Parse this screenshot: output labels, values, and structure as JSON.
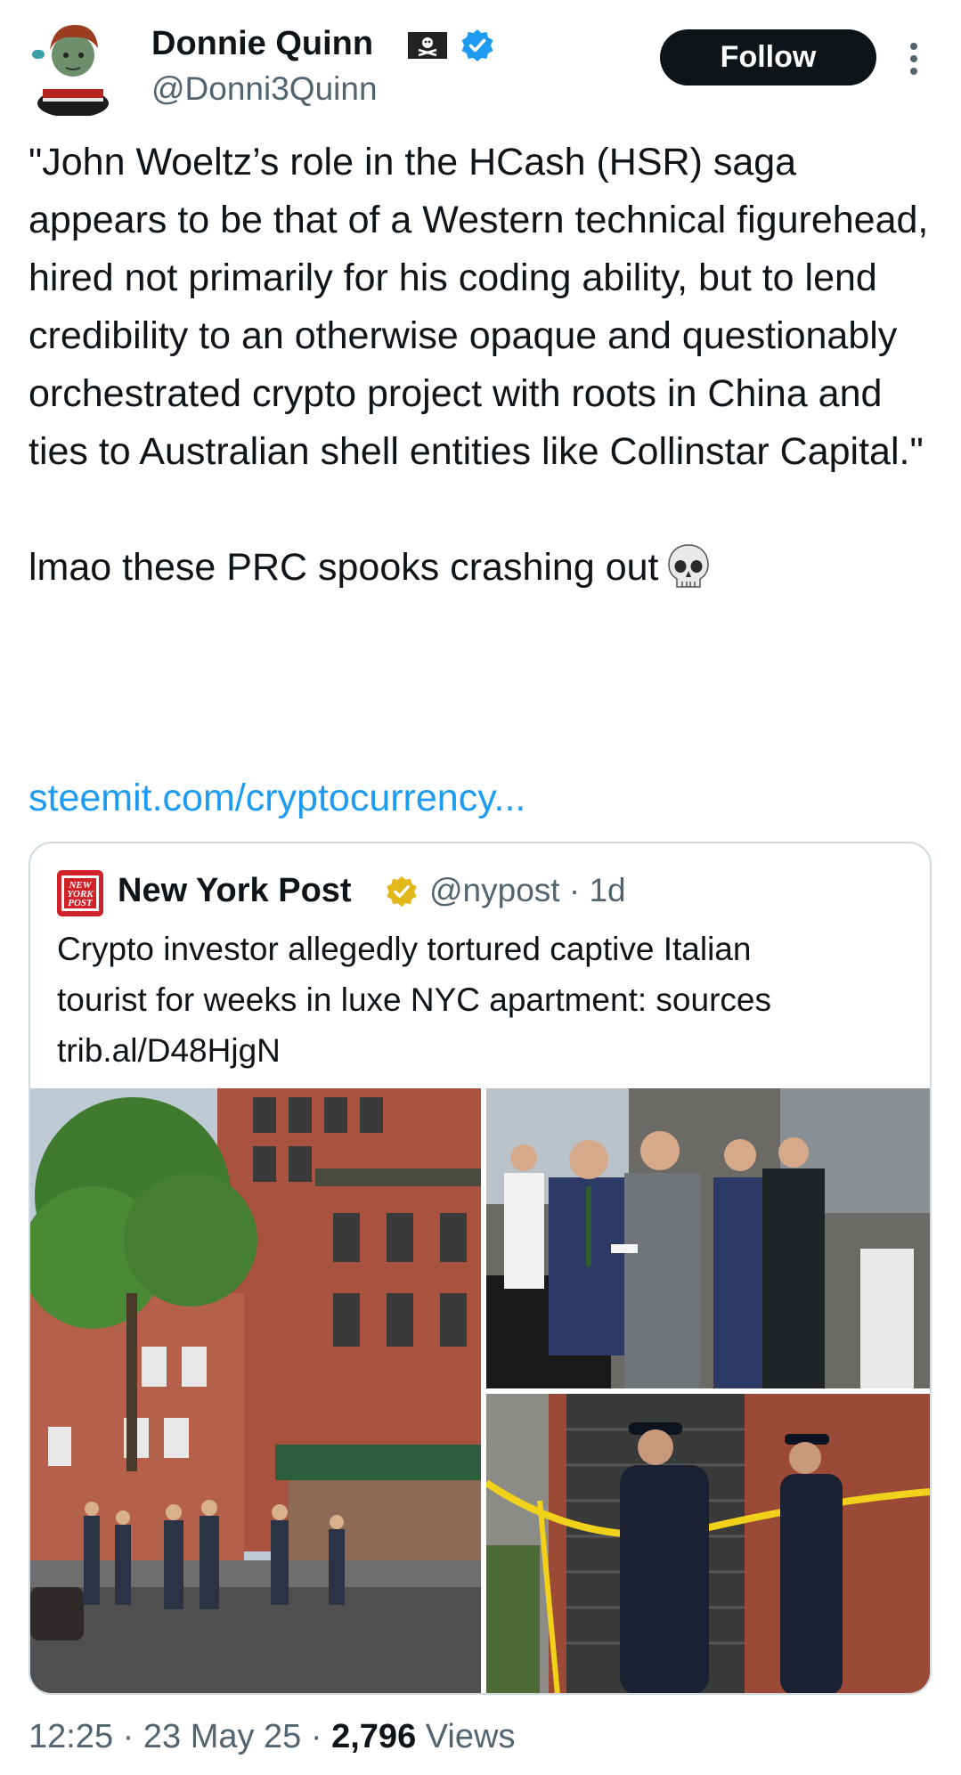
{
  "author": {
    "display_name": "Donnie Quinn",
    "handle": "@Donni3Quinn",
    "badges": [
      "pirate-flag-icon",
      "verified-blue-icon"
    ],
    "verified_color": "#1d9bf0"
  },
  "follow_button": {
    "label": "Follow"
  },
  "tweet": {
    "line1": "\"John Woeltz’s role in the HCash (HSR) saga appears to be that of a Western technical figurehead, hired not primarily for his coding ability, but to lend credibility to an otherwise opaque and questionably orchestrated crypto project with roots in China and ties to Australian shell entities like Collinstar Capital.\"",
    "line2": "lmao these PRC spooks crashing out",
    "emoji": "skull-icon",
    "link": "steemit.com/cryptocurrency..."
  },
  "quote": {
    "logo_text": "NEW YORK POST",
    "name": "New York Post",
    "handle": "@nypost",
    "separator": "·",
    "age": "1d",
    "text_lines": [
      "Crypto investor allegedly tortured captive Italian",
      "tourist for weeks in luxe NYC apartment: sources",
      "trib.al/D48HjgN"
    ],
    "verified_color": "#e2b719",
    "photos": [
      "brick-building-street-photo",
      "officials-conferring-photo",
      "police-stoop-crime-tape-photo"
    ]
  },
  "meta": {
    "time": "12:25",
    "date": "23 May 25",
    "views_count": "2,796",
    "views_label": "Views",
    "separator": "·"
  },
  "colors": {
    "link": "#1d9bf0",
    "secondary_text": "#536471",
    "border": "#cfd9de",
    "nypost_red": "#d1222a"
  }
}
